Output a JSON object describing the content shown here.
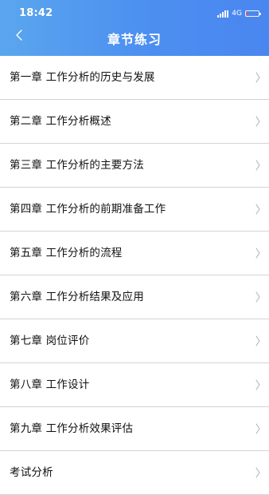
{
  "status_bar": {
    "time": "18:42",
    "network": "4G"
  },
  "header": {
    "title": "章节练习"
  },
  "chapters": [
    "第一章 工作分析的历史与发展",
    "第二章 工作分析概述",
    "第三章 工作分析的主要方法",
    "第四章 工作分析的前期准备工作",
    "第五章 工作分析的流程",
    "第六章 工作分析结果及应用",
    "第七章 岗位评价",
    "第八章 工作设计",
    "第九章 工作分析效果评估",
    "考试分析"
  ],
  "icons": {
    "back": "chevron-left-icon",
    "row_arrow": "chevron-right-icon"
  },
  "colors": {
    "header_start": "#5aa6ee",
    "header_end": "#4a86f0",
    "divider": "#d4d4d4",
    "text": "#111111",
    "battery_level": "#ff4d4d"
  }
}
